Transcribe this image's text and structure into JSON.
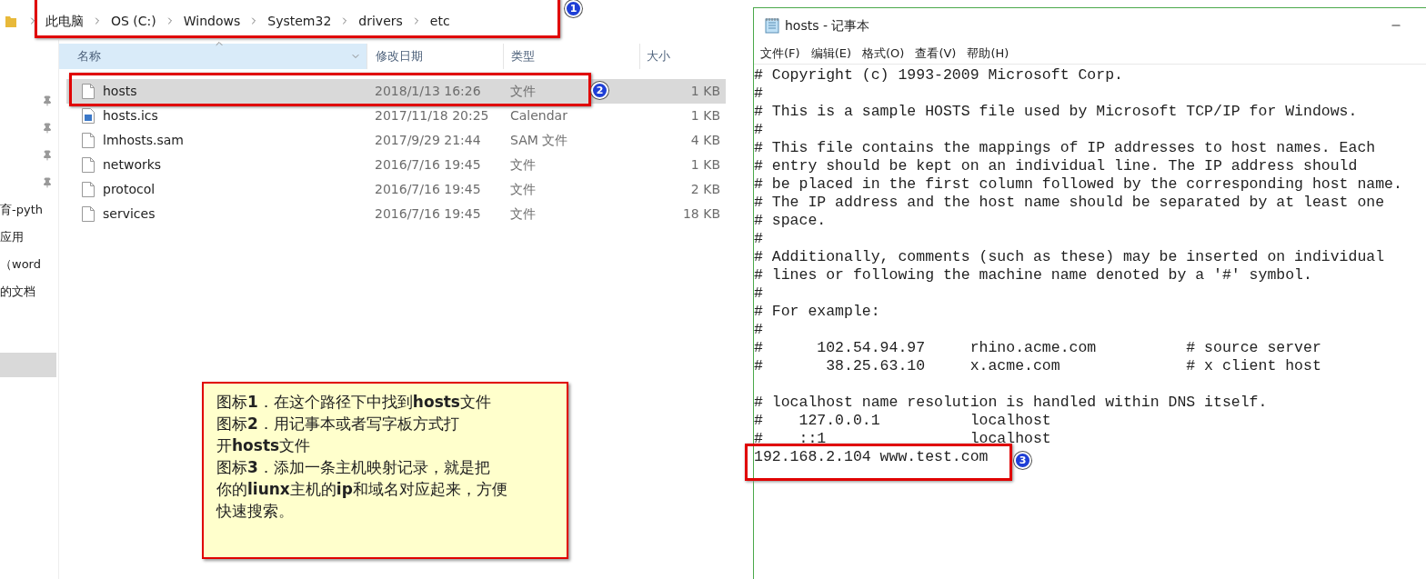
{
  "explorer": {
    "breadcrumb": [
      "此电脑",
      "OS (C:)",
      "Windows",
      "System32",
      "drivers",
      "etc"
    ],
    "nav_items": [
      {
        "kind": "pinned"
      },
      {
        "kind": "pinned"
      },
      {
        "kind": "pinned"
      },
      {
        "kind": "pinned"
      },
      {
        "kind": "text",
        "label": "育-pyth"
      },
      {
        "kind": "text",
        "label": "应用"
      },
      {
        "kind": "text",
        "label": "（word"
      },
      {
        "kind": "text",
        "label": "的文档"
      },
      {
        "kind": "blank",
        "selected": true
      }
    ],
    "columns": [
      "名称",
      "修改日期",
      "类型",
      "大小"
    ],
    "files": [
      {
        "kind": "file",
        "name": "hosts",
        "date": "2018/1/13 16:26",
        "type": "文件",
        "size": "1 KB",
        "selected": true
      },
      {
        "kind": "calendar",
        "name": "hosts.ics",
        "date": "2017/11/18 20:25",
        "type": "Calendar",
        "size": "1 KB",
        "selected": false
      },
      {
        "kind": "file",
        "name": "lmhosts.sam",
        "date": "2017/9/29 21:44",
        "type": "SAM 文件",
        "size": "4 KB",
        "selected": false
      },
      {
        "kind": "file",
        "name": "networks",
        "date": "2016/7/16 19:45",
        "type": "文件",
        "size": "1 KB",
        "selected": false
      },
      {
        "kind": "file",
        "name": "protocol",
        "date": "2016/7/16 19:45",
        "type": "文件",
        "size": "2 KB",
        "selected": false
      },
      {
        "kind": "file",
        "name": "services",
        "date": "2016/7/16 19:45",
        "type": "文件",
        "size": "18 KB",
        "selected": false
      }
    ]
  },
  "notepad": {
    "title": "hosts - 记事本",
    "menu": [
      "文件(F)",
      "编辑(E)",
      "格式(O)",
      "查看(V)",
      "帮助(H)"
    ],
    "blocks": [
      [
        "# Copyright (c) 1993-2009 Microsoft Corp.",
        "#",
        "# This is a sample HOSTS file used by Microsoft TCP/IP for Windows.",
        "#",
        "# This file contains the mappings of IP addresses to host names. Each",
        "# entry should be kept on an individual line. The IP address should",
        "# be placed in the first column followed by the corresponding host name.",
        "# The IP address and the host name should be separated by at least one",
        "# space.",
        "#",
        "# Additionally, comments (such as these) may be inserted on individual",
        "# lines or following the machine name denoted by a '#' symbol.",
        "#",
        "# For example:",
        "#",
        "#      102.54.94.97     rhino.acme.com          # source server",
        "#       38.25.63.10     x.acme.com              # x client host"
      ],
      [
        "# localhost name resolution is handled within DNS itself.",
        "#    127.0.0.1          localhost",
        "#    ::1                localhost",
        "192.168.2.104 www.test.com"
      ]
    ]
  },
  "markers": [
    "1",
    "2",
    "3"
  ],
  "callout": {
    "lines": [
      "图标**1**．在这个路径下中找到**hosts**文件",
      "图标**2**．用记事本或者写字板方式打",
      "开**hosts**文件",
      "图标**3**．添加一条主机映射记录，就是把",
      "你的**liunx**主机的**ip**和域名对应起来，方便",
      "快速搜索。"
    ]
  }
}
